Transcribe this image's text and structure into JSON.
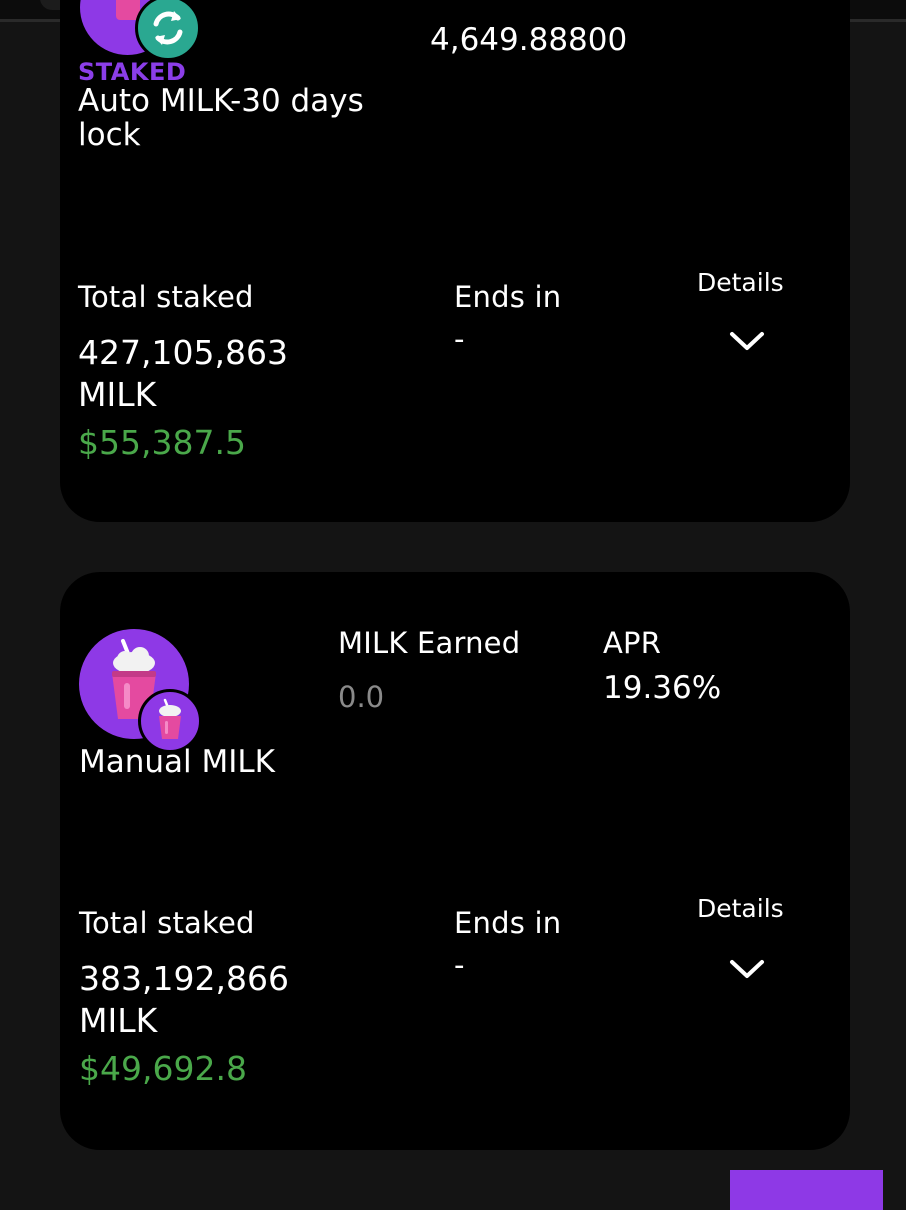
{
  "colors": {
    "accent_purple": "#8e39e6",
    "staked_tag": "#8b3ee8",
    "usd_green": "#4aa84a",
    "badge_teal": "#2aa891",
    "muted_gray": "#8a8a8a"
  },
  "pool_auto": {
    "status_tag": "STAKED",
    "name": "Auto MILK-30 days lock",
    "staked_value": "4,649.88800",
    "total_staked_label": "Total staked",
    "total_staked_value": "427,105,863 MILK",
    "total_staked_usd": "$55,387.5",
    "ends_in_label": "Ends in",
    "ends_in_value": "-",
    "details_label": "Details",
    "token_icon": "milkshake-icon",
    "badge_icon": "auto-compound-refresh-icon"
  },
  "pool_manual": {
    "name": "Manual MILK",
    "earned_label": "MILK Earned",
    "earned_value": "0.0",
    "apr_label": "APR",
    "apr_value": "19.36%",
    "total_staked_label": "Total staked",
    "total_staked_value": "383,192,866 MILK",
    "total_staked_usd": "$49,692.8",
    "ends_in_label": "Ends in",
    "ends_in_value": "-",
    "details_label": "Details",
    "token_icon": "milkshake-icon",
    "badge_icon": "milkshake-icon"
  }
}
